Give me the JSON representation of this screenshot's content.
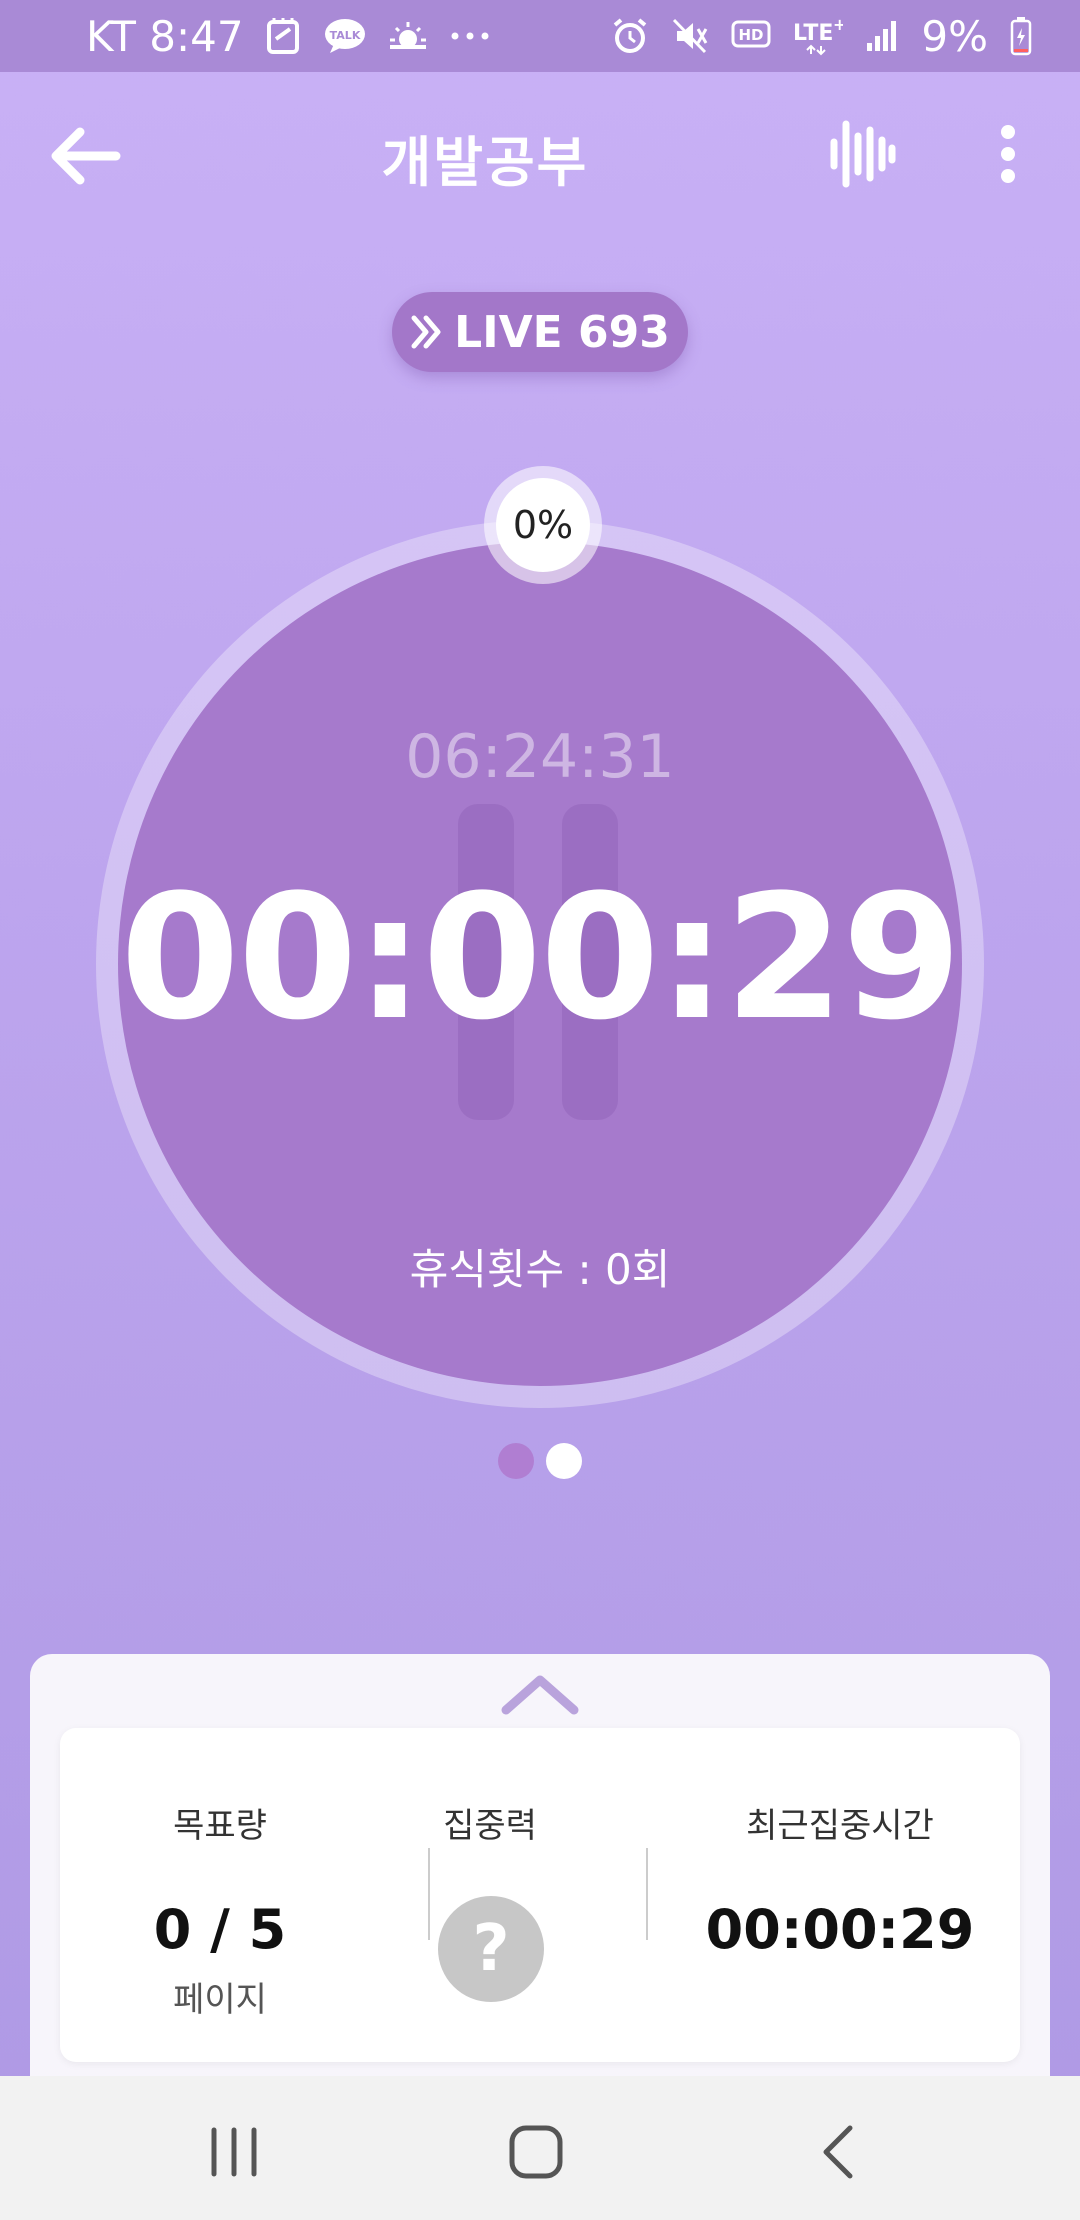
{
  "status_bar": {
    "carrier_time": "KT 8:47",
    "battery_percent": "9%",
    "left_icons": [
      "notes-icon",
      "talk-icon",
      "weather-icon",
      "more-dots-icon"
    ],
    "right_icons": [
      "alarm-icon",
      "mute-icon",
      "hd-icon",
      "lte-icon",
      "signal-icon",
      "battery-icon"
    ]
  },
  "app_bar": {
    "title": "개발공부",
    "icons": [
      "back-arrow-icon",
      "sound-wave-icon",
      "more-vertical-icon"
    ]
  },
  "live": {
    "label": "LIVE 693",
    "icon": "double-chevron-right-icon"
  },
  "timer": {
    "progress_label": "0%",
    "total_time": "06:24:31",
    "elapsed_time": "00:00:29",
    "rest_count_label": "휴식횟수 : 0회",
    "state_icon": "pause-icon"
  },
  "pager": {
    "current_page": 2,
    "page_count": 2
  },
  "stats": {
    "goal": {
      "label": "목표량",
      "value": "0 / 5",
      "unit": "페이지"
    },
    "focus": {
      "label": "집중력",
      "value": "?"
    },
    "recent": {
      "label": "최근집중시간",
      "value": "00:00:29"
    }
  },
  "colors": {
    "background_top": "#c9b1f6",
    "background_bottom": "#ae99e4",
    "circle": "#a67acc",
    "status_bar": "#a98ad6"
  },
  "nav_bar": {
    "icons": [
      "recent-apps-icon",
      "home-icon",
      "back-icon"
    ]
  }
}
